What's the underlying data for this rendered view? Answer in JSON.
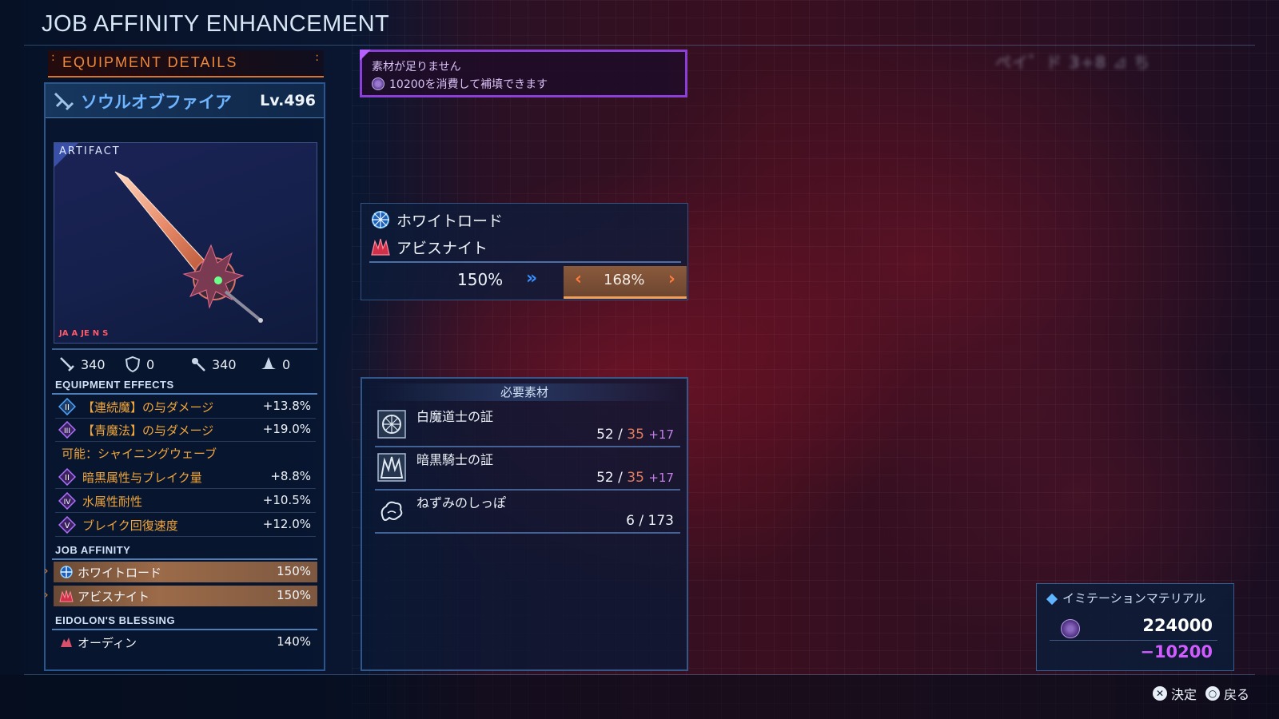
{
  "screen": {
    "title": "JOB AFFINITY ENHANCEMENT"
  },
  "equipment_details": {
    "header": "EQUIPMENT DETAILS",
    "weapon": {
      "name": "ソウルオブファイア",
      "level": "Lv.496",
      "rarity_label": "ARTIFACT",
      "job_icons": [
        "JA",
        "A",
        "JE",
        "N",
        "S"
      ]
    },
    "stats": [
      {
        "icon": "sword-icon",
        "value": "340"
      },
      {
        "icon": "shield-icon",
        "value": "0"
      },
      {
        "icon": "wand-icon",
        "value": "340"
      },
      {
        "icon": "hat-icon",
        "value": "0"
      }
    ],
    "effects_label": "EQUIPMENT EFFECTS",
    "effects": [
      {
        "tier": "II",
        "name": "【連続魔】の与ダメージ",
        "value": "+13.8%",
        "color": "#4aa8ff"
      },
      {
        "tier": "III",
        "name": "【青魔法】の与ダメージ",
        "value": "+19.0%",
        "color": "#b070ff"
      },
      {
        "tier": "II",
        "name": "暗黒属性与ブレイク量",
        "value": "+8.8%",
        "color": "#b070ff"
      },
      {
        "tier": "IV",
        "name": "水属性耐性",
        "value": "+10.5%",
        "color": "#b070ff"
      },
      {
        "tier": "V",
        "name": "ブレイク回復速度",
        "value": "+12.0%",
        "color": "#b070ff"
      }
    ],
    "possible_text": "可能：シャイニングウェーブ",
    "job_affinity_label": "JOB AFFINITY",
    "job_affinity": [
      {
        "name": "ホワイトロード",
        "value": "150%",
        "icon": "white-lord-icon"
      },
      {
        "name": "アビスナイト",
        "value": "150%",
        "icon": "abyss-knight-icon"
      }
    ],
    "eidolon_label": "EIDOLON'S BLESSING",
    "eidolon": {
      "name": "オーディン",
      "value": "140%",
      "icon": "odin-icon"
    }
  },
  "warning": {
    "title": "素材が足りません",
    "text": "10200を消費して補填できます"
  },
  "affinity_change": {
    "jobs": [
      "ホワイトロード",
      "アビスナイト"
    ],
    "from": "150%",
    "to": "168%"
  },
  "materials": {
    "header": "必要素材",
    "items": [
      {
        "name": "白魔道士の証",
        "owned": "52",
        "need": "35",
        "extra": "+17",
        "icon": "white-mage-crest-icon"
      },
      {
        "name": "暗黒騎士の証",
        "owned": "52",
        "need": "35",
        "extra": "+17",
        "icon": "dark-knight-crest-icon"
      },
      {
        "name": "ねずみのしっぽ",
        "owned": "6",
        "need": "173",
        "extra": "",
        "icon": "rat-tail-icon"
      }
    ]
  },
  "currency": {
    "name": "イミテーションマテリアル",
    "amount": "224000",
    "cost": "−10200"
  },
  "footer": {
    "confirm": {
      "glyph": "✕",
      "label": "決定"
    },
    "back": {
      "glyph": "○",
      "label": "戻る"
    }
  },
  "blurred_hud_text": "ぶれたテキスト"
}
